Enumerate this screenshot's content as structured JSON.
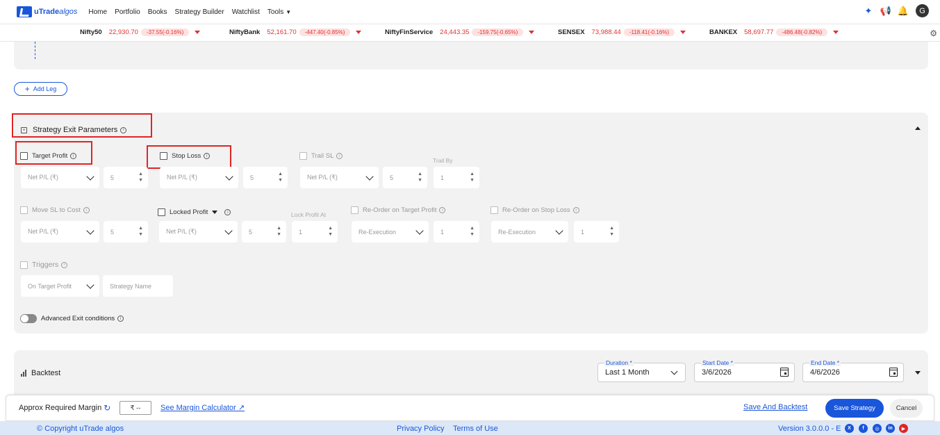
{
  "brand": {
    "logo_text_1": "uTrade",
    "logo_text_2": "algos"
  },
  "nav": [
    "Home",
    "Portfolio",
    "Books",
    "Strategy Builder",
    "Watchlist",
    "Tools"
  ],
  "user": {
    "avatar_initial": "G"
  },
  "ticker": [
    {
      "name": "Nifty50",
      "value": "22,930.70",
      "change": "-37.55(-0.16%)"
    },
    {
      "name": "NiftyBank",
      "value": "52,161.70",
      "change": "-447.40(-0.85%)"
    },
    {
      "name": "NiftyFinService",
      "value": "24,443.35",
      "change": "-159.75(-0.65%)"
    },
    {
      "name": "SENSEX",
      "value": "73,988.44",
      "change": "-118.41(-0.16%)"
    },
    {
      "name": "BANKEX",
      "value": "58,697.77",
      "change": "-486.48(-0.82%)"
    }
  ],
  "add_leg": "Add Leg",
  "exit": {
    "title": "Strategy Exit Parameters",
    "target_profit": "Target Profit",
    "stop_loss": "Stop Loss",
    "trail_sl": "Trail SL",
    "trail_by": "Trail By",
    "move_sl": "Move SL to Cost",
    "locked_profit": "Locked Profit",
    "lock_profit_at": "Lock Profit At",
    "reorder_target": "Re-Order on Target Profit",
    "reorder_sl": "Re-Order on Stop Loss",
    "triggers": "Triggers",
    "net_pl": "Net P/L (₹)",
    "num_5": "5",
    "num_1": "1",
    "reexecution": "Re-Execution",
    "on_target_profit": "On Target Profit",
    "strategy_name": "Strategy Name",
    "advanced": "Advanced Exit conditions"
  },
  "backtest": {
    "title": "Backtest",
    "duration_label": "Duration *",
    "duration_value": "Last 1 Month",
    "start_label": "Start Date *",
    "start_value": "3/6/2026",
    "end_label": "End Date *",
    "end_value": "4/6/2026"
  },
  "actions": {
    "margin_label": "Approx Required Margin",
    "margin_value": "₹ --",
    "margin_calc": "See Margin Calculator ↗",
    "save_backtest": "Save And Backtest",
    "save_strategy": "Save Strategy",
    "cancel": "Cancel"
  },
  "footer": {
    "copyright": "© Copyright uTrade algos",
    "privacy": "Privacy Policy",
    "terms": "Terms of Use",
    "version": "Version 3.0.0.0 - E"
  },
  "colors": {
    "accent": "#1a56db",
    "negative": "#e03131",
    "highlight_box": "#e02424"
  }
}
